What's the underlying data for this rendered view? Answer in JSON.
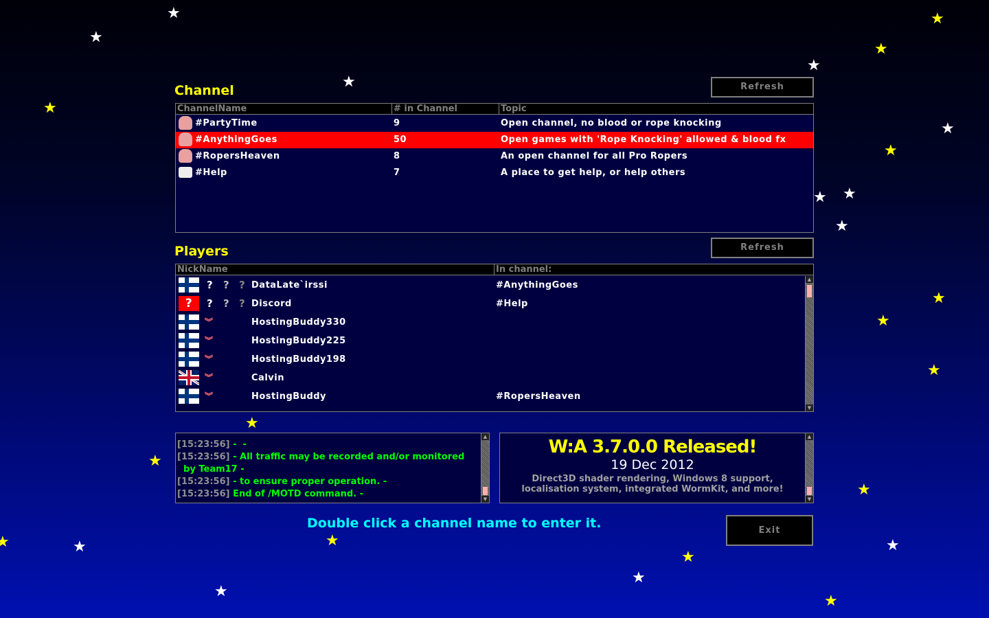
{
  "channel": {
    "title": "Channel",
    "refresh_label": "Refresh",
    "columns": [
      "ChannelName",
      "# in Channel",
      "Topic"
    ],
    "rows": [
      {
        "name": "#PartyTime",
        "count": "9",
        "topic": "Open channel, no blood or rope knocking",
        "icon": "worm-icon",
        "selected": false
      },
      {
        "name": "#AnythingGoes",
        "count": "50",
        "topic": "Open games with 'Rope Knocking' allowed & blood fx",
        "icon": "worm-icon",
        "selected": true
      },
      {
        "name": "#RopersHeaven",
        "count": "8",
        "topic": "An open channel for all Pro Ropers",
        "icon": "worm-icon",
        "selected": false
      },
      {
        "name": "#Help",
        "count": "7",
        "topic": "A place to get help, or help others",
        "icon": "chat-bubble-icon",
        "selected": false
      }
    ]
  },
  "players": {
    "title": "Players",
    "refresh_label": "Refresh",
    "columns": [
      "NickName",
      "In channel:"
    ],
    "rows": [
      {
        "flag": "finland",
        "rank": "unknown",
        "nick": "DataLate`irssi",
        "channel": "#AnythingGoes"
      },
      {
        "flag": "unknown",
        "rank": "unknown",
        "nick": "Discord",
        "channel": "#Help"
      },
      {
        "flag": "finland",
        "rank": "chevron",
        "nick": "HostingBuddy330",
        "channel": ""
      },
      {
        "flag": "finland",
        "rank": "chevron",
        "nick": "HostingBuddy225",
        "channel": ""
      },
      {
        "flag": "finland",
        "rank": "chevron",
        "nick": "HostingBuddy198",
        "channel": ""
      },
      {
        "flag": "uk",
        "rank": "chevron",
        "nick": "Calvin",
        "channel": ""
      },
      {
        "flag": "finland",
        "rank": "chevron",
        "nick": "HostingBuddy",
        "channel": "#RopersHeaven"
      }
    ]
  },
  "chat": {
    "lines": [
      {
        "time": "[15:23:56]",
        "text": " -  -"
      },
      {
        "time": "[15:23:56]",
        "text": " - All traffic may be recorded and/or monitored"
      },
      {
        "time": "",
        "text": "  by Team17 -"
      },
      {
        "time": "[15:23:56]",
        "text": " - to ensure proper operation. -"
      },
      {
        "time": "[15:23:56]",
        "text": " End of /MOTD command. -"
      }
    ]
  },
  "news": {
    "headline": "W:A 3.7.0.0 Released!",
    "date": "19 Dec 2012",
    "body1": "Direct3D shader rendering, Windows 8 support,",
    "body2": "localisation system, integrated WormKit, and more!"
  },
  "hint": "Double click a channel name to enter it.",
  "exit_label": "Exit",
  "colors": {
    "title": "#ffff00",
    "selected_row": "#ff0000",
    "chat_text": "#00ff00",
    "hint": "#00ffff"
  }
}
